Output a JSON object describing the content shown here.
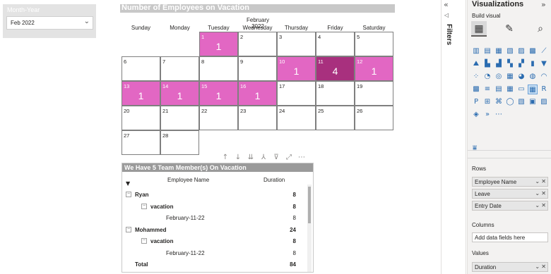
{
  "slicer": {
    "title": "Month-Year",
    "value": "Feb 2022"
  },
  "calendar": {
    "title": "Number of Employees on Vacation",
    "month_label": "February 2022",
    "weekdays": [
      "Sunday",
      "Monday",
      "Tuesday",
      "Wednesday",
      "Thursday",
      "Friday",
      "Saturday"
    ],
    "days": [
      {
        "d": "1",
        "v": "1"
      },
      {
        "d": "2",
        "v": ""
      },
      {
        "d": "3",
        "v": ""
      },
      {
        "d": "4",
        "v": ""
      },
      {
        "d": "5",
        "v": ""
      },
      {
        "d": "6",
        "v": ""
      },
      {
        "d": "7",
        "v": ""
      },
      {
        "d": "8",
        "v": ""
      },
      {
        "d": "9",
        "v": ""
      },
      {
        "d": "10",
        "v": "1"
      },
      {
        "d": "11",
        "v": "4"
      },
      {
        "d": "12",
        "v": "1"
      },
      {
        "d": "13",
        "v": "1"
      },
      {
        "d": "14",
        "v": "1"
      },
      {
        "d": "15",
        "v": "1"
      },
      {
        "d": "16",
        "v": "1"
      },
      {
        "d": "17",
        "v": ""
      },
      {
        "d": "18",
        "v": ""
      },
      {
        "d": "19",
        "v": ""
      },
      {
        "d": "20",
        "v": ""
      },
      {
        "d": "21",
        "v": ""
      },
      {
        "d": "22",
        "v": ""
      },
      {
        "d": "23",
        "v": ""
      },
      {
        "d": "24",
        "v": ""
      },
      {
        "d": "25",
        "v": ""
      },
      {
        "d": "26",
        "v": ""
      },
      {
        "d": "27",
        "v": ""
      },
      {
        "d": "28",
        "v": ""
      }
    ],
    "colors": {
      "vacation": "#e267c3",
      "vacation_high": "#a8307e"
    }
  },
  "toolbar_icons": [
    "arrow-up-icon",
    "arrow-down-icon",
    "double-arrow-down-icon",
    "fork-icon",
    "filter-icon",
    "focus-mode-icon",
    "more-options-icon"
  ],
  "matrix": {
    "title": "We Have 5 Team Member(s) On Vacation",
    "col_employee": "Employee Name",
    "col_duration": "Duration",
    "rows": [
      {
        "label": "Ryan",
        "value": "8",
        "level": 0,
        "toggle": "⊟",
        "bold": true
      },
      {
        "label": "vacation",
        "value": "8",
        "level": 1,
        "toggle": "⊟",
        "bold": true
      },
      {
        "label": "February-11-22",
        "value": "8",
        "level": 2,
        "toggle": "",
        "bold": false
      },
      {
        "label": "Mohammed",
        "value": "24",
        "level": 0,
        "toggle": "⊟",
        "bold": true
      },
      {
        "label": "vacation",
        "value": "8",
        "level": 1,
        "toggle": "⊟",
        "bold": true
      },
      {
        "label": "February-11-22",
        "value": "8",
        "level": 2,
        "toggle": "",
        "bold": false
      },
      {
        "label": "Total",
        "value": "84",
        "level": 0,
        "toggle": "",
        "bold": true
      }
    ]
  },
  "filters": {
    "label": "Filters"
  },
  "viz": {
    "title": "Visualizations",
    "build_label": "Build visual",
    "rows_label": "Rows",
    "rows": [
      "Employee Name",
      "Leave",
      "Entry Date"
    ],
    "columns_label": "Columns",
    "columns_placeholder": "Add data fields here",
    "values_label": "Values",
    "values": [
      "Duration"
    ]
  }
}
